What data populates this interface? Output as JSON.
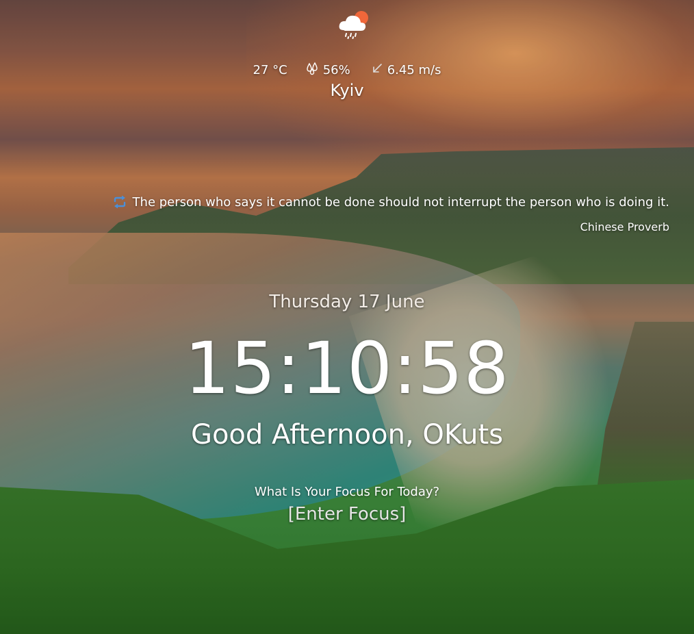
{
  "weather": {
    "icon": "cloud-rain-sun-icon",
    "temperature": "27 °C",
    "humidity": "56%",
    "humidity_icon": "droplets-icon",
    "wind": "6.45 m/s",
    "wind_icon": "wind-direction-arrow-icon",
    "city": "Kyiv"
  },
  "quote": {
    "refresh_icon": "refresh-icon",
    "text": "The person who says it cannot be done should not interrupt the person who is doing it.",
    "author": "Chinese Proverb"
  },
  "datetime": {
    "date": "Thursday 17 June",
    "time": "15:10:58"
  },
  "greeting": {
    "text": "Good Afternoon, OKuts"
  },
  "focus": {
    "question": "What Is Your Focus For Today?",
    "placeholder": "[Enter Focus]"
  },
  "colors": {
    "text": "#ffffff",
    "refresh_icon": "#4a90d9",
    "sun": "#f0673a"
  }
}
